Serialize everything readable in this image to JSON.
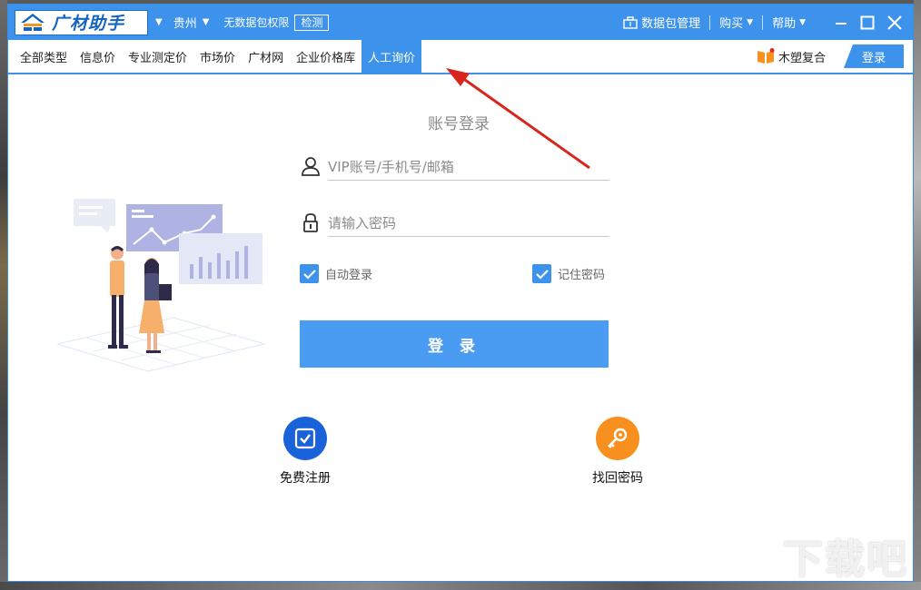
{
  "app": {
    "logo_text": "广材助手"
  },
  "titlebar": {
    "region": "贵州",
    "permission_text": "无数据包权限",
    "detect_label": "检测",
    "package_manage": "数据包管理",
    "buy": "购买",
    "help": "帮助"
  },
  "nav": {
    "items": [
      {
        "label": "全部类型"
      },
      {
        "label": "信息价"
      },
      {
        "label": "专业测定价"
      },
      {
        "label": "市场价"
      },
      {
        "label": "广材网"
      },
      {
        "label": "企业价格库"
      },
      {
        "label": "人工询价"
      }
    ],
    "active_index": 6,
    "wood_label": "木塑复合",
    "login_label": "登录"
  },
  "form": {
    "title": "账号登录",
    "account_placeholder": "VIP账号/手机号/邮箱",
    "password_placeholder": "请输入密码",
    "auto_login": "自动登录",
    "remember_password": "记住密码",
    "auto_login_checked": true,
    "remember_checked": true,
    "submit_label": "登 录"
  },
  "actions": {
    "register": "免费注册",
    "recover": "找回密码"
  },
  "colors": {
    "brand": "#3d93ec",
    "button": "#4a9cf2",
    "register_icon": "#1a62d9",
    "recover_icon": "#f7901e",
    "annotation_arrow": "#d9261c"
  },
  "watermark": "下载吧"
}
